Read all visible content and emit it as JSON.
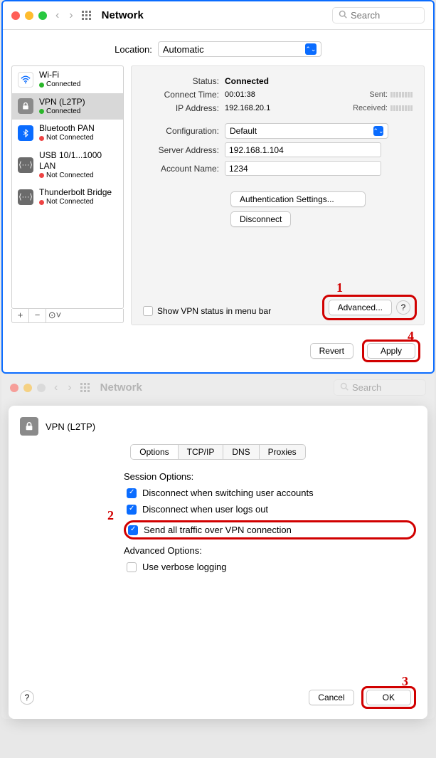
{
  "win1": {
    "title": "Network",
    "search_ph": "Search",
    "location_label": "Location:",
    "location_value": "Automatic",
    "services": [
      {
        "name": "Wi-Fi",
        "status": "Connected",
        "up": true,
        "icon": "wifi"
      },
      {
        "name": "VPN (L2TP)",
        "status": "Connected",
        "up": true,
        "icon": "vpn",
        "selected": true
      },
      {
        "name": "Bluetooth PAN",
        "status": "Not Connected",
        "up": false,
        "icon": "bt"
      },
      {
        "name": "USB 10/1...1000 LAN",
        "status": "Not Connected",
        "up": false,
        "icon": "usb"
      },
      {
        "name": "Thunderbolt Bridge",
        "status": "Not Connected",
        "up": false,
        "icon": "tb"
      }
    ],
    "listbtns": {
      "add": "+",
      "remove": "−",
      "more": "⊙˅"
    },
    "detail": {
      "status_label": "Status:",
      "status_value": "Connected",
      "connect_time_label": "Connect Time:",
      "connect_time_value": "00:01:38",
      "ip_label": "IP Address:",
      "ip_value": "192.168.20.1",
      "sent_label": "Sent:",
      "received_label": "Received:",
      "config_label": "Configuration:",
      "config_value": "Default",
      "server_label": "Server Address:",
      "server_value": "192.168.1.104",
      "account_label": "Account Name:",
      "account_value": "1234",
      "auth_btn": "Authentication Settings...",
      "disconnect_btn": "Disconnect",
      "showvpn_label": "Show VPN status in menu bar",
      "advanced_btn": "Advanced...",
      "help": "?"
    },
    "footer": {
      "revert": "Revert",
      "apply": "Apply"
    },
    "annot": {
      "n1": "1",
      "n4": "4"
    }
  },
  "win2": {
    "title": "Network",
    "search_ph": "Search",
    "sheet_title": "VPN (L2TP)",
    "tabs": [
      "Options",
      "TCP/IP",
      "DNS",
      "Proxies"
    ],
    "session_hdr": "Session Options:",
    "opt1": "Disconnect when switching user accounts",
    "opt2": "Disconnect when user logs out",
    "opt3": "Send all traffic over VPN connection",
    "adv_hdr": "Advanced Options:",
    "opt4": "Use verbose logging",
    "help": "?",
    "cancel": "Cancel",
    "ok": "OK",
    "annot": {
      "n2": "2",
      "n3": "3"
    }
  }
}
